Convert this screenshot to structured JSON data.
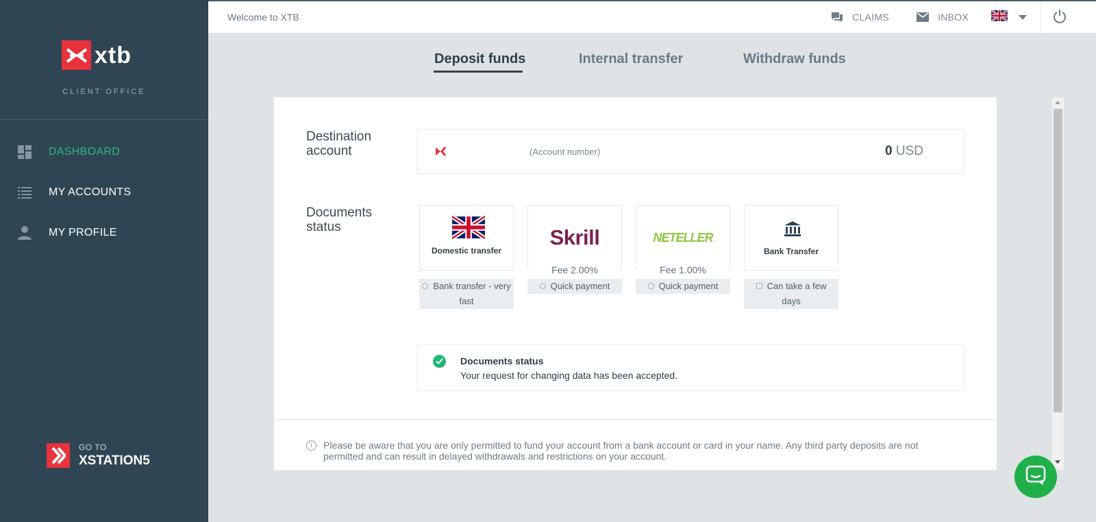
{
  "brand": {
    "name": "xtb",
    "subtitle": "CLIENT OFFICE"
  },
  "sidebar": {
    "items": [
      {
        "label": "DASHBOARD",
        "active": true
      },
      {
        "label": "MY ACCOUNTS",
        "active": false
      },
      {
        "label": "MY PROFILE",
        "active": false
      }
    ],
    "goto": {
      "small": "GO TO",
      "big": "XSTATION5"
    }
  },
  "topbar": {
    "welcome": "Welcome to XTB",
    "claims": "CLAIMS",
    "inbox": "INBOX"
  },
  "tabs": [
    "Deposit funds",
    "Internal transfer",
    "Withdraw funds"
  ],
  "destination": {
    "label": "Destination account",
    "account_number": "(Account number)",
    "amount": "0",
    "currency": "USD"
  },
  "documents_label": "Documents status",
  "methods": [
    {
      "caption": "Domestic transfer",
      "fee": "",
      "info": "Bank transfer - very fast"
    },
    {
      "caption": "Skrill",
      "fee": "Fee 2.00%",
      "info": "Quick payment"
    },
    {
      "caption": "NETELLER",
      "fee": "Fee 1.00%",
      "info": "Quick payment"
    },
    {
      "caption": "Bank Transfer",
      "fee": "",
      "info": "Can take a few days"
    }
  ],
  "status": {
    "title": "Documents status",
    "text": "Your request for changing data has been accepted."
  },
  "notice": "Please be aware that you are only permitted to fund your account from a bank account or card in your name. Any third party deposits are not permitted and can result in delayed withdrawals and restrictions on your account.",
  "colors": {
    "sidebar": "#2f4553",
    "accent_green": "#2eb67d",
    "brand_red": "#e8323c",
    "chat_green": "#1fb04a"
  }
}
